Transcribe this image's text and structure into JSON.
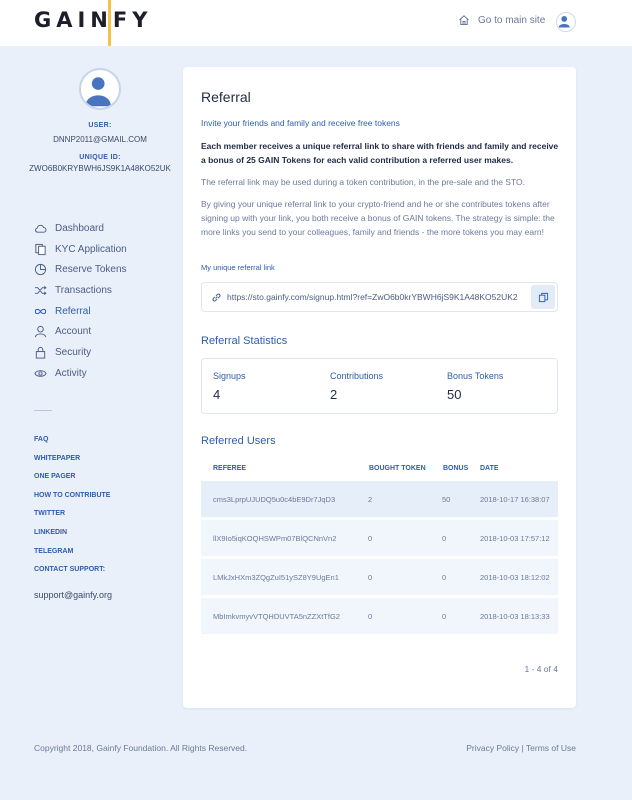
{
  "header": {
    "logo": "GAINFY",
    "goto_main_site": "Go to main site"
  },
  "profile": {
    "user_label": "USER:",
    "user_value": "DNNP2011@GMAIL.COM",
    "unique_id_label": "UNIQUE ID:",
    "unique_id_value": "ZWO6B0KRYBWH6JS9K1A48KO52UK"
  },
  "nav": [
    {
      "label": "Dashboard",
      "icon": "cloud-icon"
    },
    {
      "label": "KYC Application",
      "icon": "documents-icon"
    },
    {
      "label": "Reserve Tokens",
      "icon": "pie-chart-icon"
    },
    {
      "label": "Transactions",
      "icon": "shuffle-icon"
    },
    {
      "label": "Referral",
      "icon": "infinity-icon"
    },
    {
      "label": "Account",
      "icon": "user-icon"
    },
    {
      "label": "Security",
      "icon": "lock-icon"
    },
    {
      "label": "Activity",
      "icon": "eye-icon"
    }
  ],
  "active_nav": "Referral",
  "links": [
    "FAQ",
    "WHITEPAPER",
    "ONE PAGER",
    "HOW TO CONTRIBUTE",
    "TWITTER",
    "LINKEDIN",
    "TELEGRAM"
  ],
  "contact": {
    "label": "CONTACT SUPPORT:",
    "email": "support@gainfy.org"
  },
  "referral": {
    "title": "Referral",
    "subtitle": "Invite your friends and family and receive free tokens",
    "bold_text": "Each member receives a unique referral link to share with friends and family and receive a bonus of 25 GAIN Tokens for each valid contribution a referred user makes.",
    "text1": "The referral link may be used during a token contribution, in the pre-sale and the STO.",
    "text2": "By giving your unique referral link to your crypto-friend and he or she contributes tokens after signing up with your link, you both receive a bonus of GAIN tokens. The strategy is simple: the more links you send to your colleagues, family and friends - the more tokens you may earn!",
    "link_label": "My unique referral link",
    "link_url": "https://sto.gainfy.com/signup.html?ref=ZwO6b0krYBWH6jS9K1A48KO52UK2"
  },
  "statistics": {
    "title": "Referral Statistics",
    "items": [
      {
        "label": "Signups",
        "value": "4"
      },
      {
        "label": "Contributions",
        "value": "2"
      },
      {
        "label": "Bonus Tokens",
        "value": "50"
      }
    ]
  },
  "referred": {
    "title": "Referred Users",
    "columns": [
      "REFEREE",
      "BOUGHT TOKEN",
      "BONUS",
      "DATE"
    ],
    "rows": [
      [
        "cms3LprpUJUDQ5u0c4bE9Dr7JqD3",
        "2",
        "50",
        "2018-10-17 16:38:07"
      ],
      [
        "llX9Io5iqKOQHSWPm07BlQCNnVn2",
        "0",
        "0",
        "2018-10-03 17:57:12"
      ],
      [
        "LMkJxHXm3ZQgZuI51ySZ8Y9UgEn1",
        "0",
        "0",
        "2018-10-03 18:12:02"
      ],
      [
        "MbImkvmyvVTQHDUVTA5nZZXtTfG2",
        "0",
        "0",
        "2018-10-03 18:13:33"
      ]
    ],
    "pager": "1 - 4 of 4"
  },
  "footer": {
    "copyright": "Copyright 2018, Gainfy Foundation. All Rights Reserved.",
    "privacy": "Privacy Policy",
    "separator": "|",
    "terms": "Terms of Use"
  },
  "colors": {
    "accent": "#2e5dab",
    "logo_bar": "#f2c24a",
    "background": "#e9f0fa"
  }
}
